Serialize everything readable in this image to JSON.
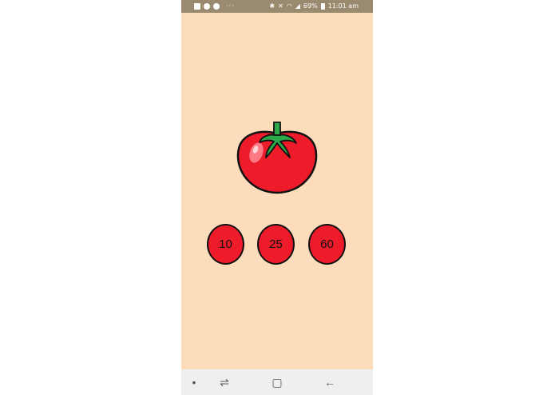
{
  "status_bar": {
    "dots": "···",
    "battery": "69%",
    "time": "11:01 am",
    "icons": [
      "gallery-icon",
      "app-icon",
      "messenger-icon",
      "bluetooth-icon",
      "mute-icon",
      "wifi-icon",
      "signal-icon",
      "battery-icon"
    ]
  },
  "timer_buttons": [
    "10",
    "25",
    "60"
  ],
  "nav_bar": {
    "icons": [
      "dot-icon",
      "recents-icon",
      "home-icon",
      "back-icon"
    ]
  },
  "colors": {
    "background": "#fcdcbb",
    "tomato_red": "#ee1b2b",
    "stem_green": "#2ca84a",
    "status_bar": "#9a8a70"
  }
}
